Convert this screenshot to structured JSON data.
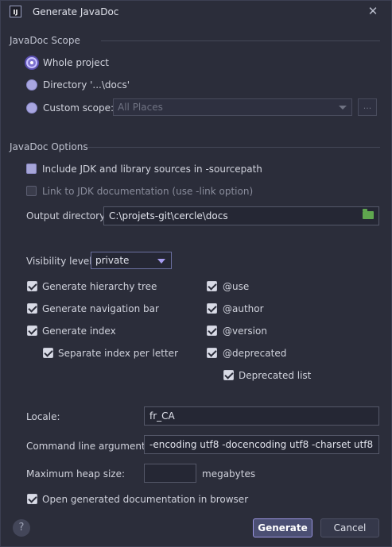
{
  "window": {
    "title": "Generate JavaDoc",
    "app_icon_text": "IJ"
  },
  "scope": {
    "title": "JavaDoc Scope",
    "options": [
      {
        "label": "Whole project",
        "checked": true
      },
      {
        "label": "Directory '...\\docs'",
        "checked": false
      },
      {
        "label": "Custom scope:",
        "checked": false
      }
    ],
    "custom_scope_value": "All Places",
    "browse_label": "..."
  },
  "options": {
    "title": "JavaDoc Options",
    "include_jdk_label": "Include JDK and library sources in -sourcepath",
    "link_jdk_label": "Link to JDK documentation (use -link option)",
    "output_dir_label": "Output directory:",
    "output_dir_value": "C:\\projets-git\\cercle\\docs",
    "visibility_label": "Visibility level:",
    "visibility_value": "private",
    "left_checks": [
      {
        "label": "Generate hierarchy tree",
        "checked": true
      },
      {
        "label": "Generate navigation bar",
        "checked": true
      },
      {
        "label": "Generate index",
        "checked": true
      },
      {
        "label": "Separate index per letter",
        "checked": true
      }
    ],
    "right_checks": [
      {
        "label": "@use",
        "checked": true
      },
      {
        "label": "@author",
        "checked": true
      },
      {
        "label": "@version",
        "checked": true
      },
      {
        "label": "@deprecated",
        "checked": true
      },
      {
        "label": "Deprecated list",
        "checked": true
      }
    ],
    "locale_label": "Locale:",
    "locale_value": "fr_CA",
    "args_label": "Command line arguments:",
    "args_value": "-encoding utf8 -docencoding utf8 -charset utf8",
    "heap_label": "Maximum heap size:",
    "heap_value": "",
    "heap_unit": "megabytes",
    "open_browser_label": "Open generated documentation in browser"
  },
  "footer": {
    "help_label": "?",
    "generate_label": "Generate",
    "cancel_label": "Cancel"
  },
  "icons": {
    "app": "intellij-icon",
    "close": "close-icon",
    "folder": "folder-icon",
    "help": "help-icon"
  },
  "colors": {
    "background": "#2b2d3a",
    "accent": "#9a94e0",
    "folder": "#5fa64e"
  }
}
